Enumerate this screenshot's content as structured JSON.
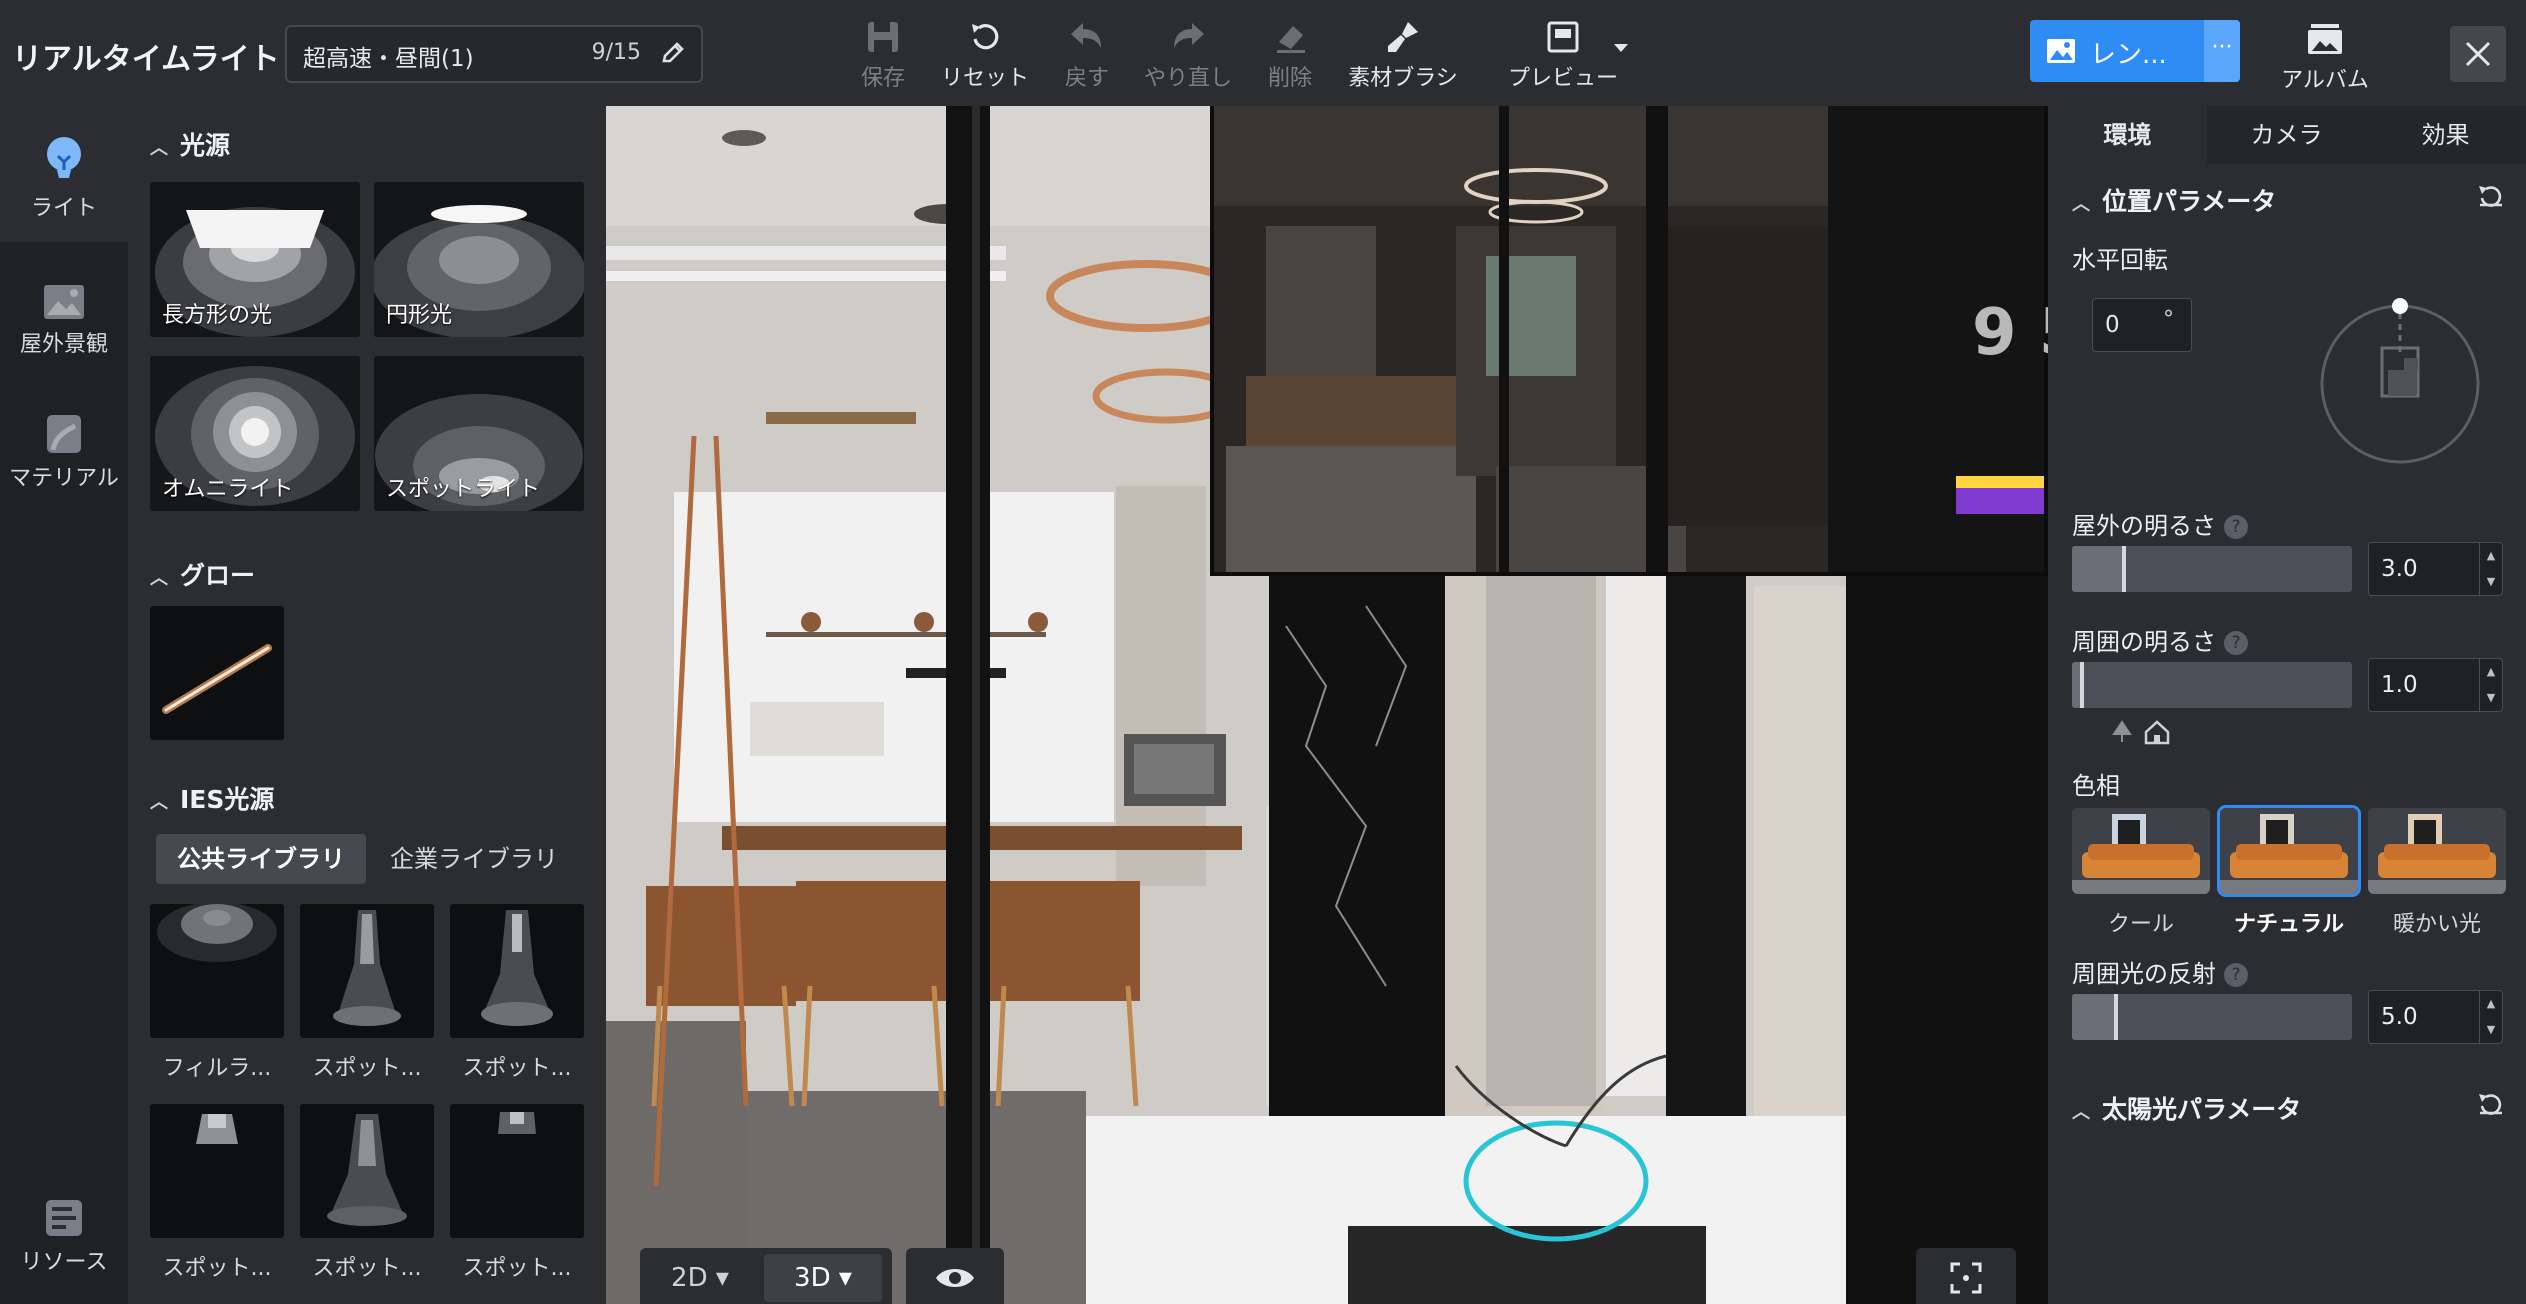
{
  "app": {
    "title": "リアルタイムライト"
  },
  "scene": {
    "name": "超高速・昼間(1)",
    "count": "9/15"
  },
  "toolbar": {
    "save": "保存",
    "reset": "リセット",
    "undo": "戻す",
    "redo": "やり直し",
    "delete": "削除",
    "material_brush": "素材ブラシ",
    "preview": "プレビュー",
    "render": "レン...",
    "render_more": "···",
    "album": "アルバム"
  },
  "rail": {
    "light": "ライト",
    "outdoor": "屋外景観",
    "material": "マテリアル",
    "resources": "リソース"
  },
  "library": {
    "light_sources": {
      "title": "光源",
      "items": [
        "長方形の光",
        "円形光",
        "オムニライト",
        "スポットライト"
      ]
    },
    "glow": {
      "title": "グロー"
    },
    "ies": {
      "title": "IES光源",
      "tabs": [
        "公共ライブラリ",
        "企業ライブラリ"
      ],
      "items": [
        "フィルラ...",
        "スポット...",
        "スポット...",
        "スポット...",
        "スポット...",
        "スポット..."
      ]
    }
  },
  "viewport": {
    "mode_2d": "2D",
    "mode_3d": "3D",
    "active_mode": "3D"
  },
  "right_panel": {
    "tabs": [
      "環境",
      "カメラ",
      "効果"
    ],
    "active_tab": "環境",
    "position": {
      "title": "位置パラメータ",
      "horizontal_rotation_label": "水平回転",
      "horizontal_rotation_value": "0",
      "degree_unit": "°"
    },
    "outdoor_brightness": {
      "label": "屋外の明るさ",
      "value": "3.0",
      "level": 0.18
    },
    "ambient_brightness": {
      "label": "周囲の明るさ",
      "value": "1.0",
      "level": 0.03
    },
    "hue": {
      "label": "色相",
      "options": [
        "クール",
        "ナチュラル",
        "暖かい光"
      ],
      "selected": "ナチュラル"
    },
    "ambient_reflection": {
      "label": "周囲光の反射",
      "value": "5.0",
      "level": 0.15
    },
    "sun": {
      "title": "太陽光パラメータ"
    }
  },
  "colors": {
    "accent": "#2f8cf5",
    "panel": "#2b2d33",
    "rail": "#1f2125"
  }
}
